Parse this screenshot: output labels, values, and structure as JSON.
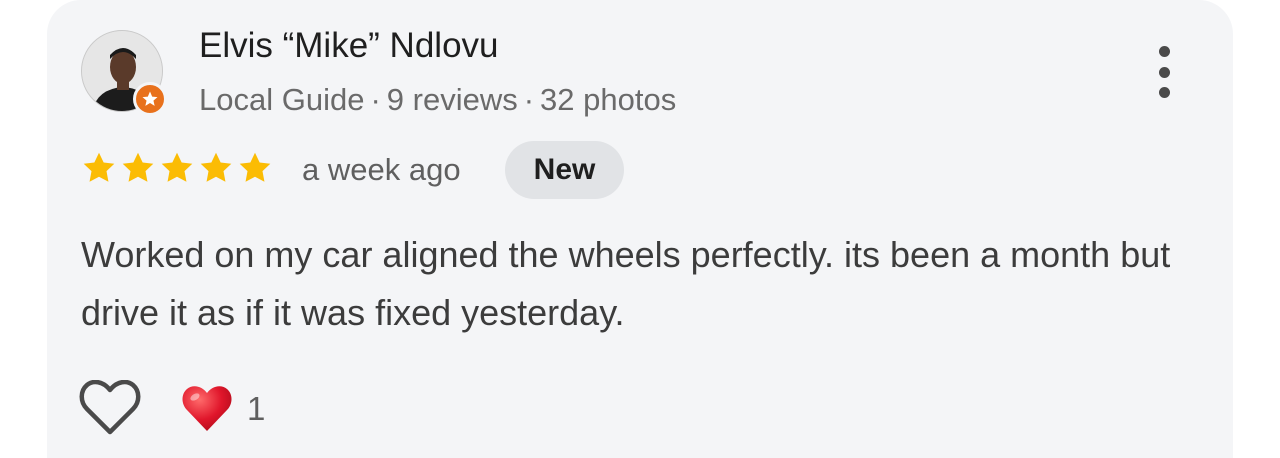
{
  "review": {
    "author": {
      "name": "Elvis “Mike” Ndlovu",
      "guide_label": "Local Guide",
      "reviews": "9 reviews",
      "photos": "32 photos",
      "avatar_icon": "user-avatar-icon",
      "badge_icon": "local-guide-star-icon"
    },
    "rating": 5,
    "rating_max": 5,
    "time": "a week ago",
    "badge": "New",
    "text": "Worked on my car aligned the wheels perfectly. its been a month but drive it as if it was fixed yesterday.",
    "reactions": {
      "like_icon": "heart-outline-icon",
      "reaction_icon": "red-heart-icon",
      "count": "1"
    },
    "menu_icon": "more-vertical-icon"
  },
  "colors": {
    "card_bg": "#f4f5f7",
    "star": "#fbbc04",
    "guide_badge": "#e8711c",
    "heart": "#e0162b",
    "new_badge_bg": "#e1e3e6"
  }
}
